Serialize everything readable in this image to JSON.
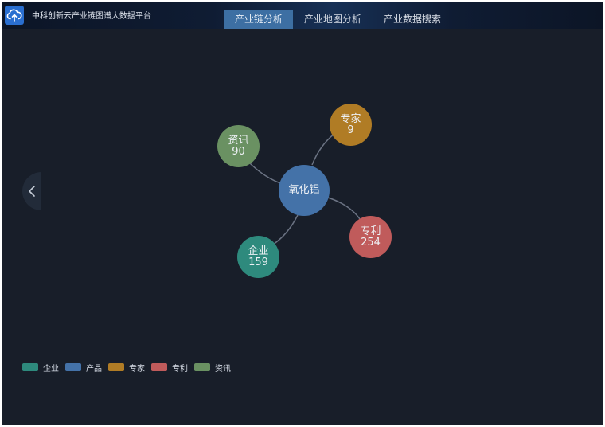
{
  "header": {
    "app_title": "中科创新云产业链图谱大数据平台",
    "logo_icon": "cloud-upload-icon",
    "tabs": [
      {
        "label": "产业链分析",
        "active": true
      },
      {
        "label": "产业地图分析",
        "active": false
      },
      {
        "label": "产业数据搜索",
        "active": false
      }
    ]
  },
  "sidebar_toggle": {
    "icon": "chevron-left-icon"
  },
  "graph": {
    "center": {
      "name": "氧化铝",
      "color": "#4472a8"
    },
    "nodes": [
      {
        "key": "news",
        "name": "资讯",
        "count": "90",
        "color": "#6a9162"
      },
      {
        "key": "expert",
        "name": "专家",
        "count": "9",
        "color": "#b07c25"
      },
      {
        "key": "patent",
        "name": "专利",
        "count": "254",
        "color": "#c05b5b"
      },
      {
        "key": "company",
        "name": "企业",
        "count": "159",
        "color": "#2e8a7d"
      }
    ]
  },
  "legend": [
    {
      "label": "企业",
      "color": "#2e8a7d"
    },
    {
      "label": "产品",
      "color": "#4472a8"
    },
    {
      "label": "专家",
      "color": "#b07c25"
    },
    {
      "label": "专利",
      "color": "#c05b5b"
    },
    {
      "label": "资讯",
      "color": "#6a9162"
    }
  ]
}
